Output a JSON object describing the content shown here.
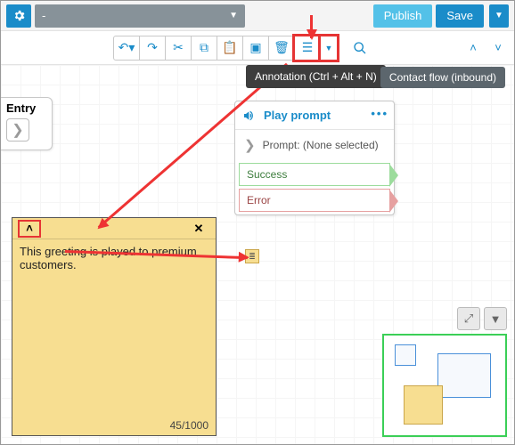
{
  "header": {
    "dropdown_label": "-",
    "publish_label": "Publish",
    "save_label": "Save"
  },
  "toolbar": {
    "tooltip": "Annotation (Ctrl + Alt + N)",
    "flow_type_pill": "Contact flow (inbound)"
  },
  "entry_block": {
    "label": "Entry"
  },
  "play_prompt": {
    "title": "Play prompt",
    "prompt_row": "Prompt: (None selected)",
    "branches": {
      "success": "Success",
      "error": "Error"
    }
  },
  "annotation": {
    "text": "This greeting is played to premium customers.",
    "count": "45/1000"
  },
  "icons": {
    "gear": "gear",
    "undo": "undo",
    "redo": "redo",
    "cut": "cut",
    "copy": "copy",
    "paste": "paste",
    "layout": "layout",
    "delete": "delete",
    "annotation": "annotation",
    "annotation_dd": "annotation-dropdown",
    "search": "search",
    "up": "up",
    "down": "down"
  }
}
